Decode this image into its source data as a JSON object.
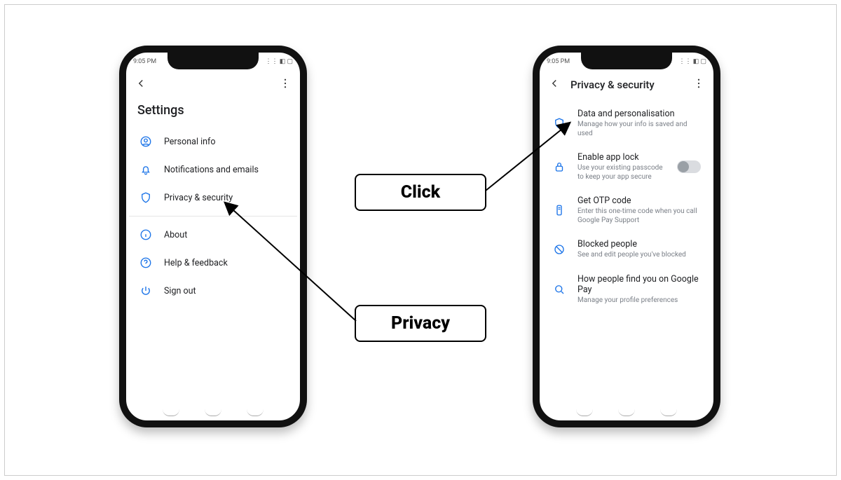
{
  "statusbar": {
    "time": "9:05 PM",
    "right": "⋮⋮ ◧ ▢"
  },
  "left": {
    "title": "Settings",
    "items": [
      {
        "label": "Personal info"
      },
      {
        "label": "Notifications and emails"
      },
      {
        "label": "Privacy & security"
      },
      {
        "label": "About"
      },
      {
        "label": "Help & feedback"
      },
      {
        "label": "Sign out"
      }
    ]
  },
  "right": {
    "title": "Privacy & security",
    "items": [
      {
        "label": "Data and personalisation",
        "sub": "Manage how your info is saved and used"
      },
      {
        "label": "Enable app lock",
        "sub": "Use your existing passcode to keep your app secure"
      },
      {
        "label": "Get OTP code",
        "sub": "Enter this one-time code when you call Google Pay Support"
      },
      {
        "label": "Blocked people",
        "sub": "See and edit people you've blocked"
      },
      {
        "label": "How people find you on Google Pay",
        "sub": "Manage your profile preferences"
      }
    ]
  },
  "callouts": {
    "click": "Click",
    "privacy": "Privacy"
  },
  "colors": {
    "accent": "#1a73e8"
  }
}
